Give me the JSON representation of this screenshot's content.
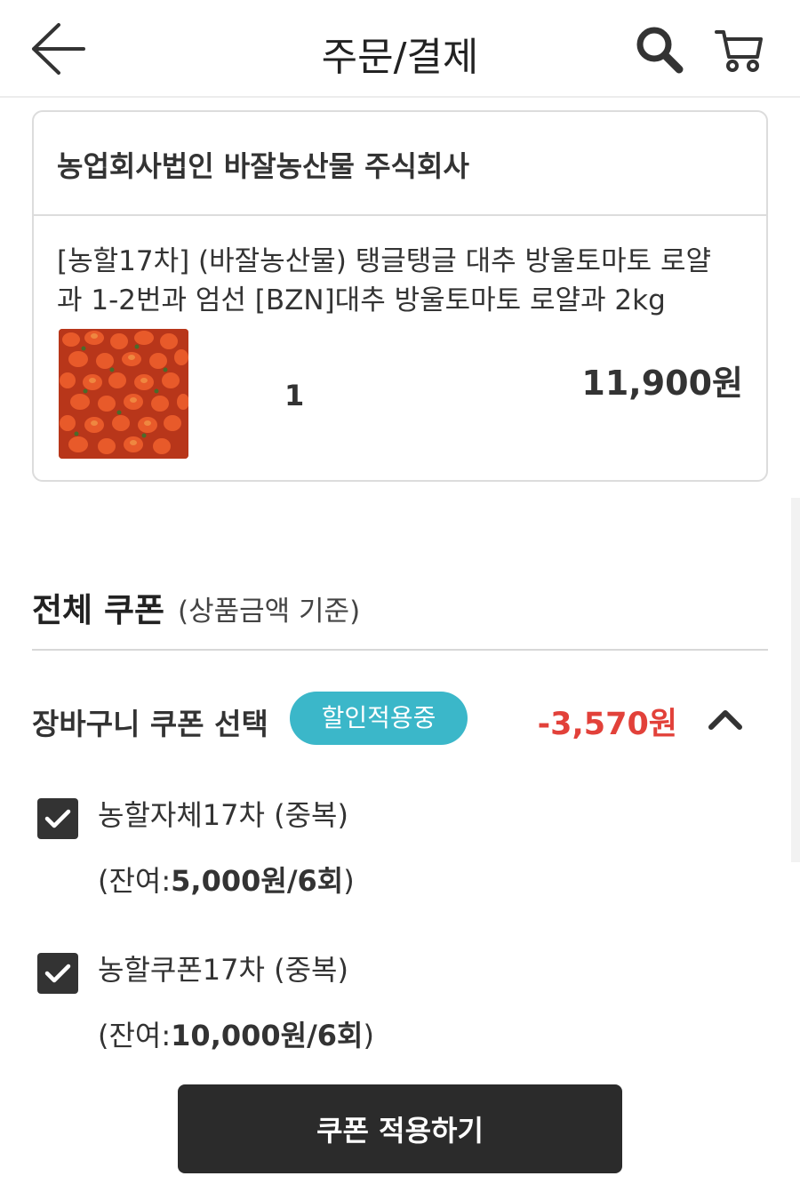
{
  "header": {
    "title": "주문/결제",
    "back_icon": "arrow-left-icon",
    "search_icon": "search-icon",
    "cart_icon": "shopping-cart-icon"
  },
  "order": {
    "seller": "농업회사법인 바잘농산물 주식회사",
    "product_name_line1": "[농할17차] (바잘농산물) 탱글탱글 대추 방울토마토 로얄",
    "product_name_line2": "과 1-2번과 엄선 [BZN]대추 방울토마토 로얄과 2kg",
    "quantity": "1",
    "price": "11,900원"
  },
  "coupons": {
    "heading": "전체 쿠폰",
    "heading_sub": "(상품금액 기준)",
    "cart_coupon_label": "장바구니 쿠폰 선택",
    "applied_badge": "할인적용중",
    "discount": "-3,570원",
    "items": [
      {
        "name": "농할자체17차 (중복)",
        "remain_prefix": "(잔여:",
        "remain_value": "5,000원/6회",
        "remain_suffix": ")",
        "checked": true
      },
      {
        "name": "농할쿠폰17차 (중복)",
        "remain_prefix": "(잔여:",
        "remain_value": "10,000원/6회",
        "remain_suffix": ")",
        "checked": true
      }
    ],
    "apply_button": "쿠폰 적용하기"
  },
  "colors": {
    "badge": "#3bb7c9",
    "discount": "#e2413a",
    "button": "#2b2b2b"
  }
}
